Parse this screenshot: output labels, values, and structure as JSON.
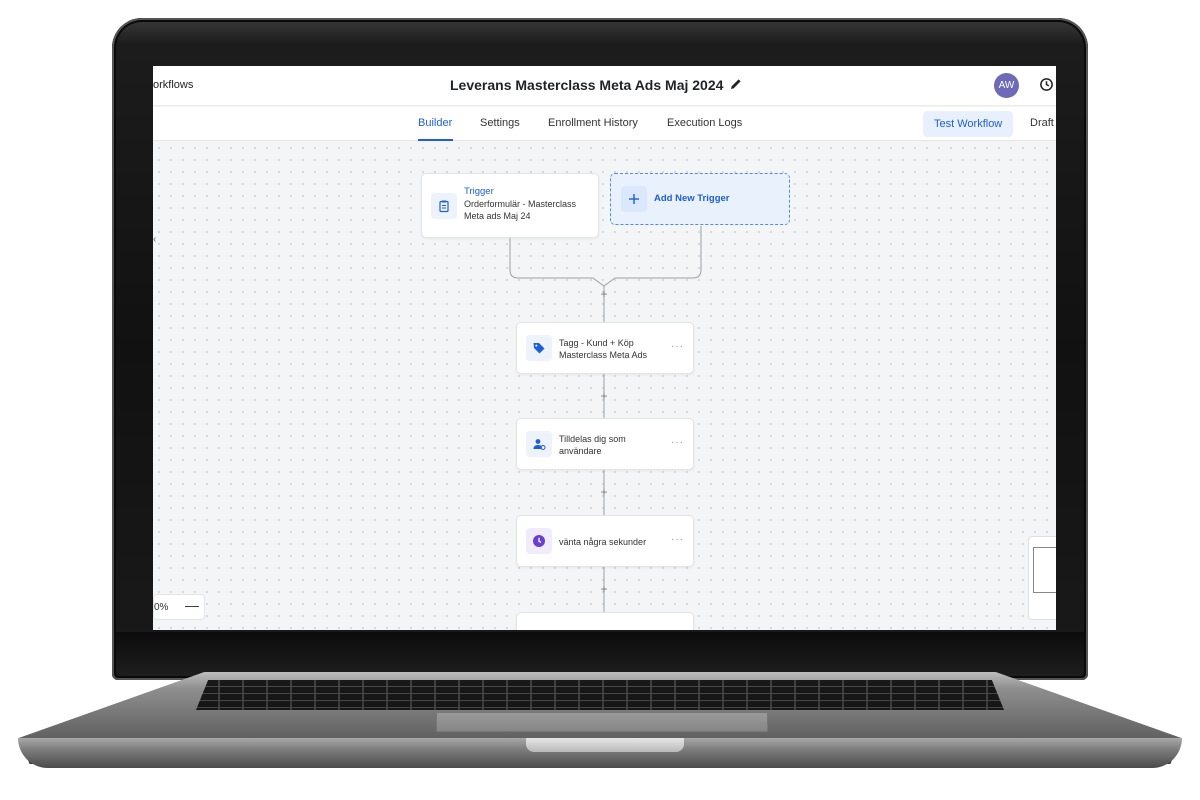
{
  "header": {
    "breadcrumb": "orkflows",
    "workflow_title": "Leverans Masterclass Meta Ads Maj 2024",
    "avatar_initials": "AW"
  },
  "tabs": [
    {
      "label": "Builder",
      "active": true
    },
    {
      "label": "Settings",
      "active": false
    },
    {
      "label": "Enrollment History",
      "active": false
    },
    {
      "label": "Execution Logs",
      "active": false
    }
  ],
  "actions": {
    "test_workflow": "Test Workflow",
    "status": "Draft"
  },
  "trigger": {
    "kind": "Trigger",
    "line1": "Orderformulär - Masterclass",
    "line2": "Meta ads Maj 24",
    "add_label": "Add New Trigger"
  },
  "steps": [
    {
      "icon": "tag-icon",
      "line1": "Tagg - Kund + Köp",
      "line2": "Masterclass Meta Ads"
    },
    {
      "icon": "assign-user-icon",
      "line1": "Tilldelas dig som",
      "line2": "användare"
    },
    {
      "icon": "clock-icon",
      "line1": "vänta några sekunder",
      "line2": ""
    }
  ],
  "zoom": {
    "label": "0%",
    "minus": "—"
  },
  "colors": {
    "accent": "#1d5fd6",
    "avatar": "#6e6ab8",
    "wait_icon": "#6a3fd0",
    "canvas": "#f4f5f7"
  }
}
